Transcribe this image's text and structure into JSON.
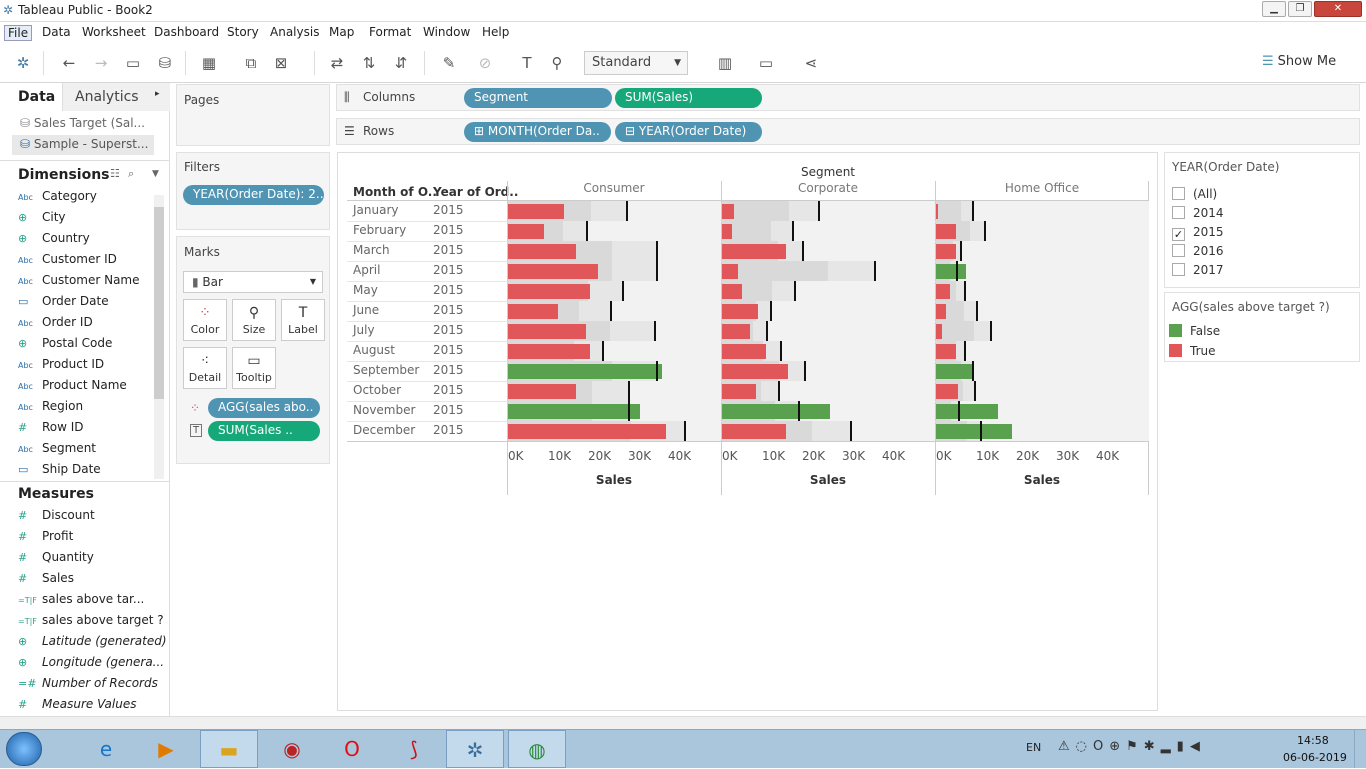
{
  "window": {
    "title": "Tableau Public - Book2"
  },
  "menu": [
    "File",
    "Data",
    "Worksheet",
    "Dashboard",
    "Story",
    "Analysis",
    "Map",
    "Format",
    "Window",
    "Help"
  ],
  "toolbar": {
    "standard": "Standard",
    "show_me": "Show Me"
  },
  "left": {
    "tab_data": "Data",
    "tab_analytics": "Analytics",
    "sources": [
      "Sales Target (Sal...",
      "Sample - Superst..."
    ],
    "dimensions_title": "Dimensions",
    "dimensions": [
      {
        "icon": "Abc",
        "name": "Category"
      },
      {
        "icon": "geo",
        "name": "City"
      },
      {
        "icon": "geo",
        "name": "Country"
      },
      {
        "icon": "Abc",
        "name": "Customer ID"
      },
      {
        "icon": "Abc",
        "name": "Customer Name"
      },
      {
        "icon": "date",
        "name": "Order Date"
      },
      {
        "icon": "Abc",
        "name": "Order ID"
      },
      {
        "icon": "geo",
        "name": "Postal Code"
      },
      {
        "icon": "Abc",
        "name": "Product ID"
      },
      {
        "icon": "Abc",
        "name": "Product Name"
      },
      {
        "icon": "Abc",
        "name": "Region"
      },
      {
        "icon": "#",
        "name": "Row ID"
      },
      {
        "icon": "Abc",
        "name": "Segment"
      },
      {
        "icon": "date",
        "name": "Ship Date"
      }
    ],
    "measures_title": "Measures",
    "measures": [
      {
        "icon": "#",
        "name": "Discount",
        "italic": false
      },
      {
        "icon": "#",
        "name": "Profit",
        "italic": false
      },
      {
        "icon": "#",
        "name": "Quantity",
        "italic": false
      },
      {
        "icon": "#",
        "name": "Sales",
        "italic": false
      },
      {
        "icon": "=T|F",
        "name": "sales above tar...",
        "italic": false
      },
      {
        "icon": "=T|F",
        "name": "sales above target ?",
        "italic": false
      },
      {
        "icon": "geo",
        "name": "Latitude (generated)",
        "italic": true
      },
      {
        "icon": "geo",
        "name": "Longitude (genera...",
        "italic": true
      },
      {
        "icon": "=#",
        "name": "Number of Records",
        "italic": true
      },
      {
        "icon": "#",
        "name": "Measure Values",
        "italic": true
      }
    ]
  },
  "cards": {
    "pages_title": "Pages",
    "filters_title": "Filters",
    "filter_pill": "YEAR(Order Date): 2..",
    "marks_title": "Marks",
    "mark_type": "Bar",
    "mark_buttons": [
      "Color",
      "Size",
      "Label",
      "Detail",
      "Tooltip"
    ],
    "mark_pills": [
      "AGG(sales abo..",
      "SUM(Sales .."
    ]
  },
  "shelves": {
    "columns_label": "Columns",
    "rows_label": "Rows",
    "columns": [
      "Segment",
      "SUM(Sales)"
    ],
    "rows": [
      "MONTH(Order Da..",
      "YEAR(Order Date)"
    ]
  },
  "legend": {
    "year_title": "YEAR(Order Date)",
    "year_items": [
      "(All)",
      "2014",
      "2015",
      "2016",
      "2017"
    ],
    "year_checked": [
      false,
      false,
      true,
      false,
      false
    ],
    "agg_title": "AGG(sales above target ?)",
    "agg_items": [
      {
        "label": "False",
        "color": "#59a14f"
      },
      {
        "label": "True",
        "color": "#e15759"
      }
    ]
  },
  "chart_data": {
    "type": "bar",
    "title": "Segment",
    "row_headers": [
      "Month of O..",
      "Year of Ord.."
    ],
    "months": [
      "January",
      "February",
      "March",
      "April",
      "May",
      "June",
      "July",
      "August",
      "September",
      "October",
      "November",
      "December"
    ],
    "year": "2015",
    "segments": [
      "Consumer",
      "Corporate",
      "Home Office"
    ],
    "xlabel": "Sales",
    "xticks": [
      "0K",
      "10K",
      "20K",
      "30K",
      "40K"
    ],
    "xlim": [
      0,
      45000
    ],
    "colors": {
      "above": "#59a14f",
      "below": "#e15759"
    },
    "series": [
      {
        "name": "Consumer",
        "sales": [
          14000,
          9000,
          17000,
          22500,
          20500,
          12500,
          19500,
          20500,
          38500,
          17000,
          33000,
          39500
        ],
        "target": [
          29500,
          19500,
          37000,
          37000,
          28500,
          25500,
          36500,
          23500,
          37000,
          30000,
          30000,
          44000
        ],
        "above": [
          false,
          false,
          false,
          false,
          false,
          false,
          false,
          false,
          true,
          false,
          true,
          false
        ]
      },
      {
        "name": "Corporate",
        "sales": [
          3000,
          2500,
          16000,
          4000,
          5000,
          9000,
          7000,
          11000,
          16500,
          8500,
          27000,
          16000
        ],
        "target": [
          24000,
          17500,
          20000,
          38000,
          18000,
          12000,
          11000,
          14500,
          20500,
          14000,
          19000,
          32000
        ],
        "above": [
          false,
          false,
          false,
          false,
          false,
          false,
          false,
          false,
          false,
          false,
          true,
          false
        ]
      },
      {
        "name": "Home Office",
        "sales": [
          500,
          5000,
          5000,
          7500,
          3500,
          2500,
          1500,
          5000,
          9000,
          5500,
          15500,
          19000
        ],
        "target": [
          9000,
          12000,
          6000,
          5000,
          7000,
          10000,
          13500,
          7000,
          9000,
          9500,
          5500,
          11000
        ],
        "above": [
          false,
          false,
          false,
          true,
          false,
          false,
          false,
          false,
          true,
          false,
          true,
          true
        ]
      }
    ]
  },
  "taskbar": {
    "lang": "EN",
    "time": "14:58",
    "date": "06-06-2019"
  }
}
